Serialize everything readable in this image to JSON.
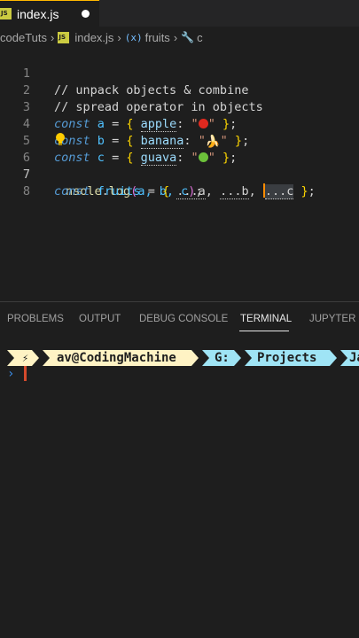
{
  "tab": {
    "badge": "JS",
    "title": "index.js"
  },
  "breadcrumb": {
    "folder": "codeTuts",
    "file": "index.js",
    "badge": "JS",
    "var_icon": "(x)",
    "var_name": "fruits",
    "const_name": "c"
  },
  "editor": {
    "line_numbers": [
      "1",
      "2",
      "3",
      "4",
      "5",
      "6",
      "7",
      "8"
    ],
    "active_line": "7",
    "l1": "// unpack objects & combine",
    "l2": "// spread operator in objects",
    "kw_const": "const",
    "l3_var": "a",
    "l3_key": "apple",
    "l4_var": "b",
    "l4_key": "banana",
    "l5_var": "c",
    "l5_key": "guava",
    "l6_console": "nsole",
    "l6_log": "log",
    "l6_args": "a, b, c",
    "l7_var": "fruits",
    "spread_a": "...a",
    "spread_b": "...b",
    "spread_c": "...c",
    "banana_glyph": "🍌"
  },
  "panel": {
    "tabs": [
      "PROBLEMS",
      "OUTPUT",
      "DEBUG CONSOLE",
      "TERMINAL",
      "JUPYTER"
    ],
    "active_tab": "TERMINAL"
  },
  "terminal": {
    "bolt": "⚡",
    "user": "av@CodingMachine",
    "drive": "G:",
    "dir1": "Projects",
    "dir2_partial": "Ja",
    "prompt_glyph": "›"
  },
  "colors": {
    "accent": "#ffb800",
    "terminal_prompt_bg": "#fff3c4",
    "terminal_path_bg": "#9fe4f5"
  }
}
